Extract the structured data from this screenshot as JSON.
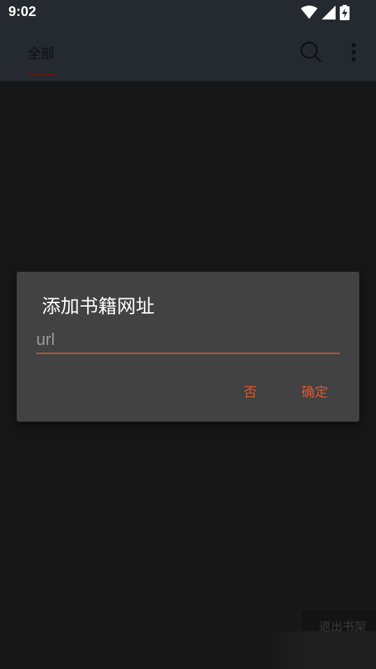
{
  "status_bar": {
    "time": "9:02"
  },
  "app_bar": {
    "tab_label": "全部",
    "icons": [
      "search-icon",
      "more-vert-icon"
    ]
  },
  "dialog": {
    "title": "添加书籍网址",
    "input_placeholder": "url",
    "input_value": "",
    "cancel_label": "否",
    "confirm_label": "确定"
  },
  "bottom": {
    "exit_shelf_label": "退出书架"
  },
  "colors": {
    "accent": "#e0572f",
    "dialog_bg": "#424242",
    "screen_bg": "#171717",
    "bar_bg": "#242a30"
  }
}
